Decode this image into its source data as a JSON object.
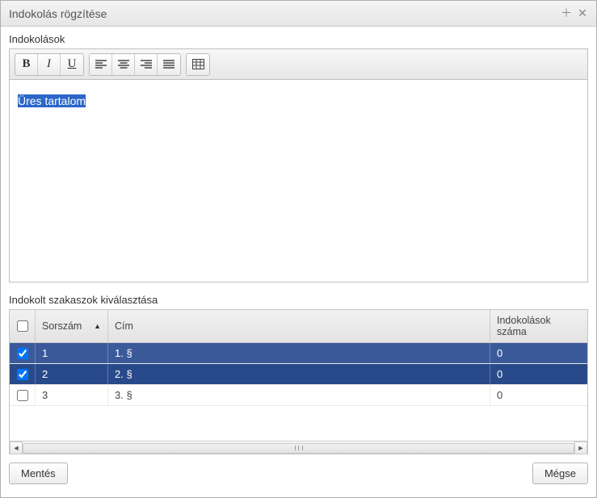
{
  "window": {
    "title": "Indokolás rögzítése"
  },
  "editor": {
    "label": "Indokolások",
    "content": "Üres tartalom"
  },
  "sections": {
    "label": "Indokolt szakaszok kiválasztása",
    "columns": {
      "sorszam": "Sorszám",
      "cim": "Cím",
      "count": "Indokolások száma"
    },
    "rows": [
      {
        "checked": true,
        "sorszam": "1",
        "cim": "1. §",
        "count": "0",
        "selected": true
      },
      {
        "checked": true,
        "sorszam": "2",
        "cim": "2. §",
        "count": "0",
        "selected": true
      },
      {
        "checked": false,
        "sorszam": "3",
        "cim": "3. §",
        "count": "0",
        "selected": false
      }
    ]
  },
  "buttons": {
    "save": "Mentés",
    "cancel": "Mégse"
  }
}
